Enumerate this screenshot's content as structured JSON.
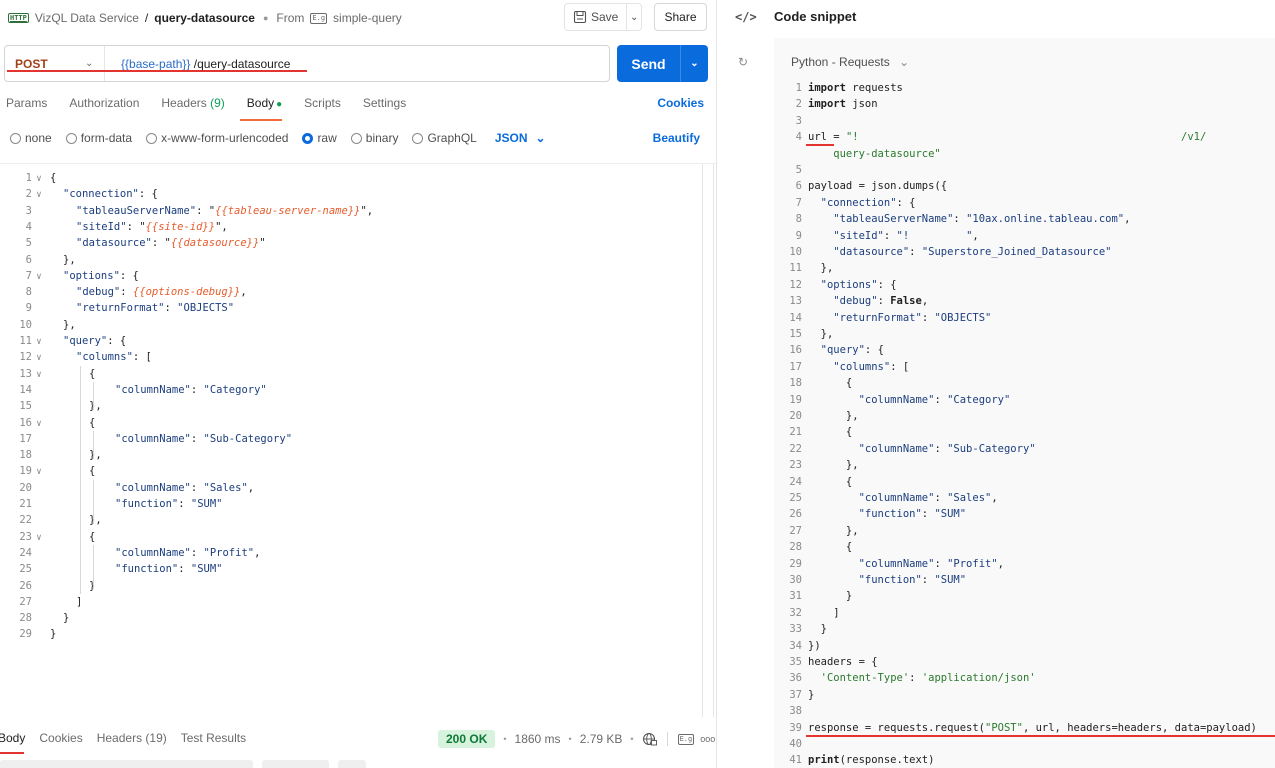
{
  "breadcrumb": {
    "http_badge": "HTTP",
    "collection": "VizQL Data Service",
    "separator": "/",
    "request_name": "query-datasource",
    "from_prefix": "From",
    "from_icon_text": "E.g",
    "from_name": "simple-query"
  },
  "toolbar": {
    "save_label": "Save",
    "share_label": "Share"
  },
  "request": {
    "method": "POST",
    "url_var": "{{base-path}}",
    "url_path": " /query-datasource",
    "send_label": "Send"
  },
  "req_tabs": {
    "params": "Params",
    "authorization": "Authorization",
    "headers": "Headers",
    "headers_count": "(9)",
    "body": "Body",
    "scripts": "Scripts",
    "settings": "Settings",
    "cookies": "Cookies"
  },
  "body_types": {
    "none": "none",
    "form_data": "form-data",
    "urlencoded": "x-www-form-urlencoded",
    "raw": "raw",
    "binary": "binary",
    "graphql": "GraphQL",
    "format": "JSON",
    "beautify": "Beautify"
  },
  "body_code": [
    {
      "n": "1",
      "fold": true,
      "indent": 0,
      "parts": [
        [
          "pun",
          "{"
        ]
      ]
    },
    {
      "n": "2",
      "fold": true,
      "indent": 1,
      "parts": [
        [
          "key",
          "\"connection\""
        ],
        [
          "pun",
          ": {"
        ]
      ]
    },
    {
      "n": "3",
      "fold": false,
      "indent": 2,
      "parts": [
        [
          "key",
          "\"tableauServerName\""
        ],
        [
          "pun",
          ": \""
        ],
        [
          "var",
          "{{tableau-server-name}}"
        ],
        [
          "pun",
          "\","
        ]
      ]
    },
    {
      "n": "4",
      "fold": false,
      "indent": 2,
      "parts": [
        [
          "key",
          "\"siteId\""
        ],
        [
          "pun",
          ": \""
        ],
        [
          "var",
          "{{site-id}}"
        ],
        [
          "pun",
          "\","
        ]
      ]
    },
    {
      "n": "5",
      "fold": false,
      "indent": 2,
      "parts": [
        [
          "key",
          "\"datasource\""
        ],
        [
          "pun",
          ": \""
        ],
        [
          "var",
          "{{datasource}}"
        ],
        [
          "pun",
          "\""
        ]
      ]
    },
    {
      "n": "6",
      "fold": false,
      "indent": 1,
      "parts": [
        [
          "pun",
          "},"
        ]
      ]
    },
    {
      "n": "7",
      "fold": true,
      "indent": 1,
      "parts": [
        [
          "key",
          "\"options\""
        ],
        [
          "pun",
          ": {"
        ]
      ]
    },
    {
      "n": "8",
      "fold": false,
      "indent": 2,
      "parts": [
        [
          "key",
          "\"debug\""
        ],
        [
          "pun",
          ": "
        ],
        [
          "var",
          "{{options-debug}}"
        ],
        [
          "pun",
          ","
        ]
      ]
    },
    {
      "n": "9",
      "fold": false,
      "indent": 2,
      "parts": [
        [
          "key",
          "\"returnFormat\""
        ],
        [
          "pun",
          ": "
        ],
        [
          "str",
          "\"OBJECTS\""
        ]
      ]
    },
    {
      "n": "10",
      "fold": false,
      "indent": 1,
      "parts": [
        [
          "pun",
          "},"
        ]
      ]
    },
    {
      "n": "11",
      "fold": true,
      "indent": 1,
      "parts": [
        [
          "key",
          "\"query\""
        ],
        [
          "pun",
          ": {"
        ]
      ]
    },
    {
      "n": "12",
      "fold": true,
      "indent": 2,
      "parts": [
        [
          "key",
          "\"columns\""
        ],
        [
          "pun",
          ": ["
        ]
      ]
    },
    {
      "n": "13",
      "fold": true,
      "indent": 3,
      "parts": [
        [
          "pun",
          "{"
        ]
      ]
    },
    {
      "n": "14",
      "fold": false,
      "indent": 5,
      "parts": [
        [
          "key",
          "\"columnName\""
        ],
        [
          "pun",
          ": "
        ],
        [
          "str",
          "\"Category\""
        ]
      ]
    },
    {
      "n": "15",
      "fold": false,
      "indent": 3,
      "parts": [
        [
          "pun",
          "},"
        ]
      ]
    },
    {
      "n": "16",
      "fold": true,
      "indent": 3,
      "parts": [
        [
          "pun",
          "{"
        ]
      ]
    },
    {
      "n": "17",
      "fold": false,
      "indent": 5,
      "parts": [
        [
          "key",
          "\"columnName\""
        ],
        [
          "pun",
          ": "
        ],
        [
          "str",
          "\"Sub-Category\""
        ]
      ]
    },
    {
      "n": "18",
      "fold": false,
      "indent": 3,
      "parts": [
        [
          "pun",
          "},"
        ]
      ]
    },
    {
      "n": "19",
      "fold": true,
      "indent": 3,
      "parts": [
        [
          "pun",
          "{"
        ]
      ]
    },
    {
      "n": "20",
      "fold": false,
      "indent": 5,
      "parts": [
        [
          "key",
          "\"columnName\""
        ],
        [
          "pun",
          ": "
        ],
        [
          "str",
          "\"Sales\""
        ],
        [
          "pun",
          ","
        ]
      ]
    },
    {
      "n": "21",
      "fold": false,
      "indent": 5,
      "parts": [
        [
          "key",
          "\"function\""
        ],
        [
          "pun",
          ": "
        ],
        [
          "str",
          "\"SUM\""
        ]
      ]
    },
    {
      "n": "22",
      "fold": false,
      "indent": 3,
      "parts": [
        [
          "pun",
          "},"
        ]
      ]
    },
    {
      "n": "23",
      "fold": true,
      "indent": 3,
      "parts": [
        [
          "pun",
          "{"
        ]
      ]
    },
    {
      "n": "24",
      "fold": false,
      "indent": 5,
      "parts": [
        [
          "key",
          "\"columnName\""
        ],
        [
          "pun",
          ": "
        ],
        [
          "str",
          "\"Profit\""
        ],
        [
          "pun",
          ","
        ]
      ]
    },
    {
      "n": "25",
      "fold": false,
      "indent": 5,
      "parts": [
        [
          "key",
          "\"function\""
        ],
        [
          "pun",
          ": "
        ],
        [
          "str",
          "\"SUM\""
        ]
      ]
    },
    {
      "n": "26",
      "fold": false,
      "indent": 3,
      "parts": [
        [
          "pun",
          "}"
        ]
      ]
    },
    {
      "n": "27",
      "fold": false,
      "indent": 2,
      "parts": [
        [
          "pun",
          "]"
        ]
      ]
    },
    {
      "n": "28",
      "fold": false,
      "indent": 1,
      "parts": [
        [
          "pun",
          "}"
        ]
      ]
    },
    {
      "n": "29",
      "fold": false,
      "indent": 0,
      "parts": [
        [
          "pun",
          "}"
        ]
      ]
    }
  ],
  "response_tabs": {
    "body": "Body",
    "cookies": "Cookies",
    "headers": "Headers (19)",
    "test_results": "Test Results",
    "status": "200 OK",
    "time": "1860 ms",
    "size": "2.79 KB",
    "sep": "•",
    "more": "ooo"
  },
  "snippet": {
    "icon": "</>",
    "title": "Code snippet",
    "language": "Python - Requests",
    "lines": [
      {
        "n": "1",
        "parts": [
          [
            "kw",
            "import"
          ],
          [
            "pdef",
            " requests"
          ]
        ]
      },
      {
        "n": "2",
        "parts": [
          [
            "kw",
            "import"
          ],
          [
            "pdef",
            " json"
          ]
        ]
      },
      {
        "n": "3",
        "parts": []
      },
      {
        "n": "4",
        "parts": [
          [
            "pdef",
            "url = "
          ],
          [
            "pstr",
            "\"!"
          ],
          [
            "pdef",
            "                                                   "
          ],
          [
            "pstr",
            "/v1/"
          ]
        ]
      },
      {
        "n": "",
        "parts": [
          [
            "pstr",
            "    query-datasource\""
          ]
        ]
      },
      {
        "n": "5",
        "parts": []
      },
      {
        "n": "6",
        "parts": [
          [
            "pdef",
            "payload = json.dumps({"
          ]
        ]
      },
      {
        "n": "7",
        "parts": [
          [
            "pdef",
            "  "
          ],
          [
            "pkey",
            "\"connection\""
          ],
          [
            "pdef",
            ": {"
          ]
        ]
      },
      {
        "n": "8",
        "parts": [
          [
            "pdef",
            "    "
          ],
          [
            "pkey",
            "\"tableauServerName\""
          ],
          [
            "pdef",
            ": "
          ],
          [
            "pkey",
            "\"10ax.online.tableau.com\""
          ],
          [
            "pdef",
            ","
          ]
        ]
      },
      {
        "n": "9",
        "parts": [
          [
            "pdef",
            "    "
          ],
          [
            "pkey",
            "\"siteId\""
          ],
          [
            "pdef",
            ": "
          ],
          [
            "pkey",
            "\"!         \""
          ],
          [
            "pdef",
            ","
          ]
        ]
      },
      {
        "n": "10",
        "parts": [
          [
            "pdef",
            "    "
          ],
          [
            "pkey",
            "\"datasource\""
          ],
          [
            "pdef",
            ": "
          ],
          [
            "pkey",
            "\"Superstore_Joined_Datasource\""
          ]
        ]
      },
      {
        "n": "11",
        "parts": [
          [
            "pdef",
            "  },"
          ]
        ]
      },
      {
        "n": "12",
        "parts": [
          [
            "pdef",
            "  "
          ],
          [
            "pkey",
            "\"options\""
          ],
          [
            "pdef",
            ": {"
          ]
        ]
      },
      {
        "n": "13",
        "parts": [
          [
            "pdef",
            "    "
          ],
          [
            "pkey",
            "\"debug\""
          ],
          [
            "pdef",
            ": "
          ],
          [
            "kw",
            "False"
          ],
          [
            "pdef",
            ","
          ]
        ]
      },
      {
        "n": "14",
        "parts": [
          [
            "pdef",
            "    "
          ],
          [
            "pkey",
            "\"returnFormat\""
          ],
          [
            "pdef",
            ": "
          ],
          [
            "pkey",
            "\"OBJECTS\""
          ]
        ]
      },
      {
        "n": "15",
        "parts": [
          [
            "pdef",
            "  },"
          ]
        ]
      },
      {
        "n": "16",
        "parts": [
          [
            "pdef",
            "  "
          ],
          [
            "pkey",
            "\"query\""
          ],
          [
            "pdef",
            ": {"
          ]
        ]
      },
      {
        "n": "17",
        "parts": [
          [
            "pdef",
            "    "
          ],
          [
            "pkey",
            "\"columns\""
          ],
          [
            "pdef",
            ": ["
          ]
        ]
      },
      {
        "n": "18",
        "parts": [
          [
            "pdef",
            "      {"
          ]
        ]
      },
      {
        "n": "19",
        "parts": [
          [
            "pdef",
            "        "
          ],
          [
            "pkey",
            "\"columnName\""
          ],
          [
            "pdef",
            ": "
          ],
          [
            "pkey",
            "\"Category\""
          ]
        ]
      },
      {
        "n": "20",
        "parts": [
          [
            "pdef",
            "      },"
          ]
        ]
      },
      {
        "n": "21",
        "parts": [
          [
            "pdef",
            "      {"
          ]
        ]
      },
      {
        "n": "22",
        "parts": [
          [
            "pdef",
            "        "
          ],
          [
            "pkey",
            "\"columnName\""
          ],
          [
            "pdef",
            ": "
          ],
          [
            "pkey",
            "\"Sub-Category\""
          ]
        ]
      },
      {
        "n": "23",
        "parts": [
          [
            "pdef",
            "      },"
          ]
        ]
      },
      {
        "n": "24",
        "parts": [
          [
            "pdef",
            "      {"
          ]
        ]
      },
      {
        "n": "25",
        "parts": [
          [
            "pdef",
            "        "
          ],
          [
            "pkey",
            "\"columnName\""
          ],
          [
            "pdef",
            ": "
          ],
          [
            "pkey",
            "\"Sales\""
          ],
          [
            "pdef",
            ","
          ]
        ]
      },
      {
        "n": "26",
        "parts": [
          [
            "pdef",
            "        "
          ],
          [
            "pkey",
            "\"function\""
          ],
          [
            "pdef",
            ": "
          ],
          [
            "pkey",
            "\"SUM\""
          ]
        ]
      },
      {
        "n": "27",
        "parts": [
          [
            "pdef",
            "      },"
          ]
        ]
      },
      {
        "n": "28",
        "parts": [
          [
            "pdef",
            "      {"
          ]
        ]
      },
      {
        "n": "29",
        "parts": [
          [
            "pdef",
            "        "
          ],
          [
            "pkey",
            "\"columnName\""
          ],
          [
            "pdef",
            ": "
          ],
          [
            "pkey",
            "\"Profit\""
          ],
          [
            "pdef",
            ","
          ]
        ]
      },
      {
        "n": "30",
        "parts": [
          [
            "pdef",
            "        "
          ],
          [
            "pkey",
            "\"function\""
          ],
          [
            "pdef",
            ": "
          ],
          [
            "pkey",
            "\"SUM\""
          ]
        ]
      },
      {
        "n": "31",
        "parts": [
          [
            "pdef",
            "      }"
          ]
        ]
      },
      {
        "n": "32",
        "parts": [
          [
            "pdef",
            "    ]"
          ]
        ]
      },
      {
        "n": "33",
        "parts": [
          [
            "pdef",
            "  }"
          ]
        ]
      },
      {
        "n": "34",
        "parts": [
          [
            "pdef",
            "})"
          ]
        ]
      },
      {
        "n": "35",
        "parts": [
          [
            "pdef",
            "headers = {"
          ]
        ]
      },
      {
        "n": "36",
        "parts": [
          [
            "pdef",
            "  "
          ],
          [
            "pstr",
            "'Content-Type'"
          ],
          [
            "pdef",
            ": "
          ],
          [
            "pstr",
            "'application/json'"
          ]
        ]
      },
      {
        "n": "37",
        "parts": [
          [
            "pdef",
            "}"
          ]
        ]
      },
      {
        "n": "38",
        "parts": []
      },
      {
        "n": "39",
        "parts": [
          [
            "pdef",
            "response = requests.request("
          ],
          [
            "pstr",
            "\"POST\""
          ],
          [
            "pdef",
            ", url, headers=headers, data=payload)"
          ]
        ]
      },
      {
        "n": "40",
        "parts": []
      },
      {
        "n": "41",
        "parts": [
          [
            "kw",
            "print"
          ],
          [
            "pdef",
            "(response.text)"
          ]
        ]
      }
    ]
  },
  "colors": {
    "accent": "#0a6bdc",
    "method": "#a2421b",
    "annotation_red": "#e3342f",
    "json_var": "#e65d2d",
    "ok_bg": "#d7f2dd"
  }
}
